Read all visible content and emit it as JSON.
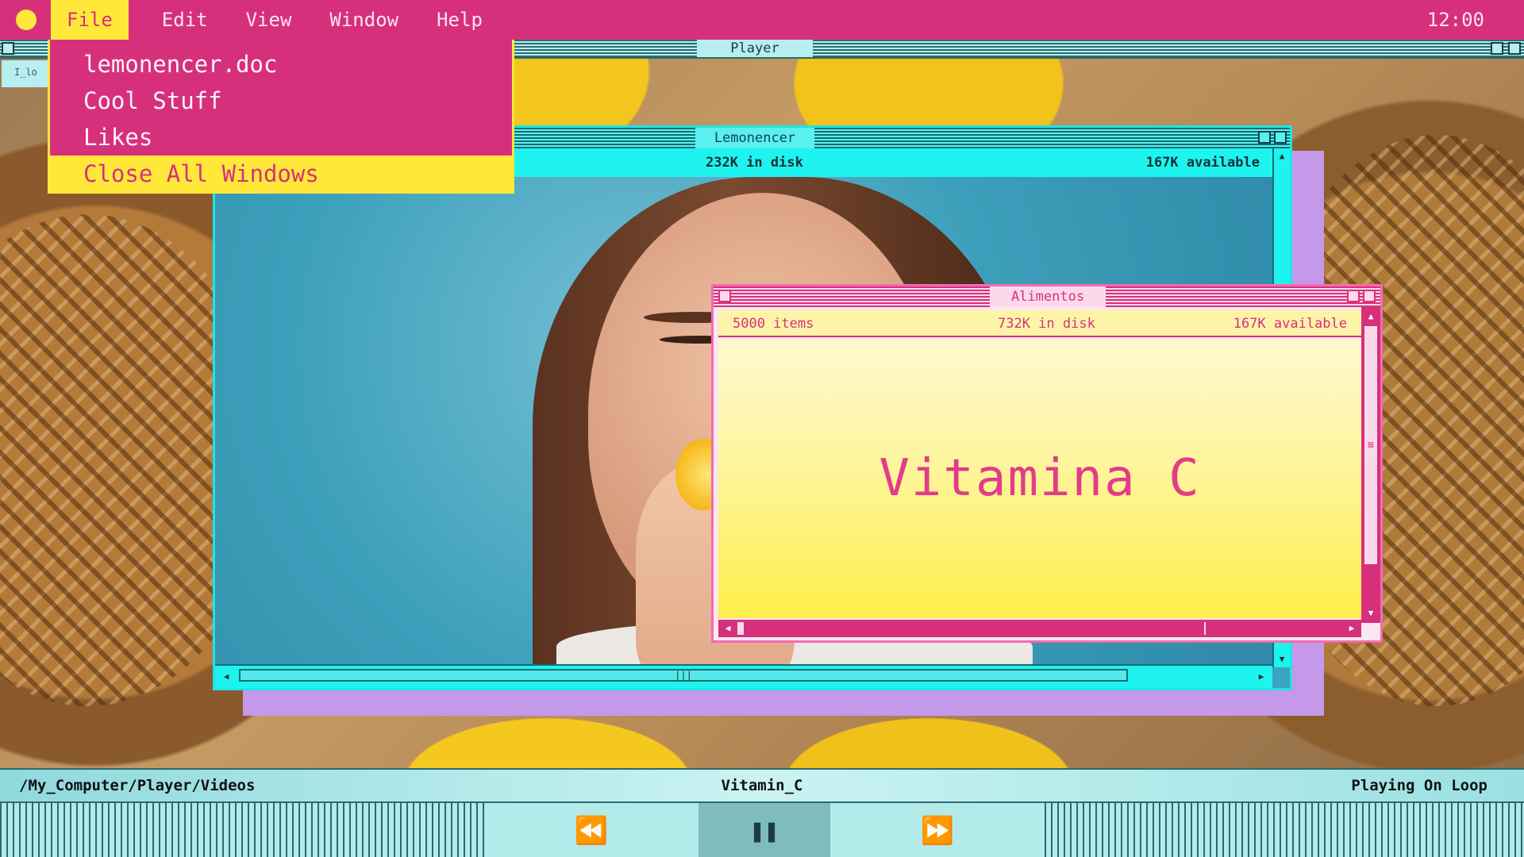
{
  "menubar": {
    "items": [
      "File",
      "Edit",
      "View",
      "Window",
      "Help"
    ],
    "clock": "12:00"
  },
  "file_menu": {
    "items": [
      "lemonencer.doc",
      "Cool Stuff",
      "Likes",
      "Close All Windows"
    ]
  },
  "player": {
    "title": "Player",
    "left_label": "I_lo"
  },
  "lemonencer": {
    "title": "Lemonencer",
    "disk": "232K in disk",
    "available": "167K available"
  },
  "alimentos": {
    "title": "Alimentos",
    "items": "5000 items",
    "disk": "732K in disk",
    "available": "167K available",
    "content": "Vitamina C"
  },
  "status": {
    "path": "/My_Computer/Player/Videos",
    "now_playing": "Vitamin_C",
    "mode": "Playing On Loop"
  },
  "colors": {
    "menubar": "#d6307d",
    "highlight": "#ffe83a",
    "cyan": "#1ff3f0"
  }
}
